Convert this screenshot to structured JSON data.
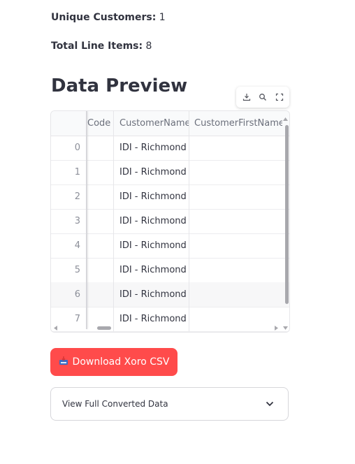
{
  "stats": {
    "unique_customers_label": "Unique Customers:",
    "unique_customers_value": "1",
    "total_line_items_label": "Total Line Items:",
    "total_line_items_value": "8"
  },
  "section_title": "Data Preview",
  "toolbar": {
    "icons": [
      "download-icon",
      "search-icon",
      "fullscreen-icon"
    ]
  },
  "table": {
    "columns": [
      "Code",
      "CustomerName",
      "CustomerFirstName"
    ],
    "rows": [
      {
        "index": "0",
        "code": "",
        "customer_name": "IDI - Richmond",
        "customer_first_name": ""
      },
      {
        "index": "1",
        "code": "",
        "customer_name": "IDI - Richmond",
        "customer_first_name": ""
      },
      {
        "index": "2",
        "code": "",
        "customer_name": "IDI - Richmond",
        "customer_first_name": ""
      },
      {
        "index": "3",
        "code": "",
        "customer_name": "IDI - Richmond",
        "customer_first_name": ""
      },
      {
        "index": "4",
        "code": "",
        "customer_name": "IDI - Richmond",
        "customer_first_name": ""
      },
      {
        "index": "5",
        "code": "",
        "customer_name": "IDI - Richmond",
        "customer_first_name": ""
      },
      {
        "index": "6",
        "code": "",
        "customer_name": "IDI - Richmond",
        "customer_first_name": ""
      },
      {
        "index": "7",
        "code": "",
        "customer_name": "IDI - Richmond",
        "customer_first_name": ""
      }
    ],
    "highlighted_row": "6"
  },
  "download_button": {
    "label": "Download Xoro CSV",
    "icon": "inbox-tray-icon"
  },
  "expander": {
    "label": "View Full Converted Data",
    "icon": "chevron-down-icon"
  },
  "colors": {
    "primary": "#ff4b4b",
    "text": "#31333f",
    "muted": "#6b6f7b",
    "border": "#e6e6e9"
  }
}
